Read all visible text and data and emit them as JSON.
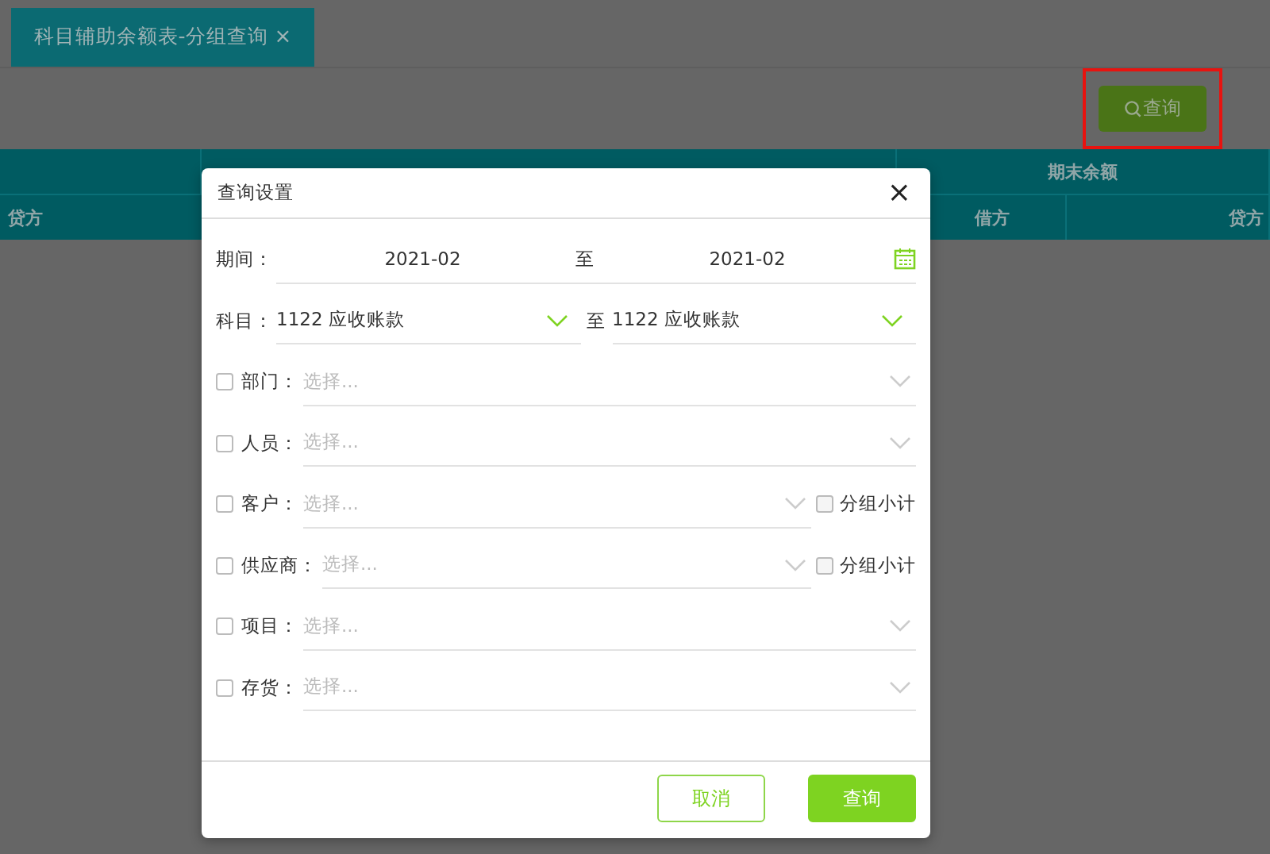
{
  "tab": {
    "title": "科目辅助余额表-分组查询",
    "close": "×",
    "selected": true
  },
  "toolbar": {
    "query_button": {
      "label": "查询",
      "highlighted": true
    }
  },
  "table": {
    "header_groups": [
      "期末余额"
    ],
    "columns": [
      "贷方",
      "借方",
      "贷方"
    ]
  },
  "dialog": {
    "title": "查询设置",
    "close": "×",
    "period": {
      "label": "期间：",
      "from": "2021-02",
      "separator": "至",
      "to": "2021-02"
    },
    "subject": {
      "label": "科目：",
      "from": "1122 应收账款",
      "separator": "至",
      "to": "1122 应收账款"
    },
    "filters": [
      {
        "label": "部门：",
        "placeholder": "选择...",
        "checked": false
      },
      {
        "label": "人员：",
        "placeholder": "选择...",
        "checked": false
      },
      {
        "label": "客户：",
        "placeholder": "选择...",
        "checked": false,
        "subtotal": {
          "label": "分组小计",
          "checked": false
        }
      },
      {
        "label": "供应商：",
        "placeholder": "选择...",
        "checked": false,
        "subtotal": {
          "label": "分组小计",
          "checked": false
        }
      },
      {
        "label": "项目：",
        "placeholder": "选择...",
        "checked": false
      },
      {
        "label": "存货：",
        "placeholder": "选择...",
        "checked": false
      }
    ],
    "buttons": {
      "cancel": "取消",
      "ok": "查询"
    }
  }
}
